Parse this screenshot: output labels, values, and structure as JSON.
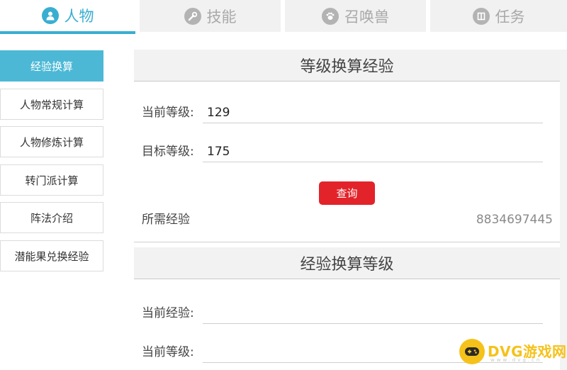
{
  "tabs": [
    {
      "label": "人物",
      "icon": "person-icon",
      "active": true
    },
    {
      "label": "技能",
      "icon": "wrench-icon",
      "active": false
    },
    {
      "label": "召唤兽",
      "icon": "beast-icon",
      "active": false
    },
    {
      "label": "任务",
      "icon": "book-icon",
      "active": false
    }
  ],
  "sidebar": {
    "items": [
      {
        "label": "经验换算",
        "active": true
      },
      {
        "label": "人物常规计算"
      },
      {
        "label": "人物修炼计算"
      },
      {
        "label": "转门派计算"
      },
      {
        "label": "阵法介绍"
      },
      {
        "label": "潜能果兑换经验"
      }
    ]
  },
  "level_to_exp": {
    "title": "等级换算经验",
    "current_level_label": "当前等级:",
    "current_level_value": "129",
    "target_level_label": "目标等级:",
    "target_level_value": "175",
    "query_button": "查询",
    "result_label": "所需经验",
    "result_value": "8834697445"
  },
  "exp_to_level": {
    "title": "经验换算等级",
    "current_exp_label": "当前经验:",
    "current_exp_value": "",
    "current_level_label": "当前等级:",
    "current_level_value": ""
  },
  "watermark": {
    "text": "DVG游戏网",
    "sub": "www.dvg.cn"
  },
  "colors": {
    "accent": "#3aaed1",
    "sidebar_active": "#4cb8d6",
    "button": "#e2232a",
    "watermark": "#f5c21a"
  }
}
